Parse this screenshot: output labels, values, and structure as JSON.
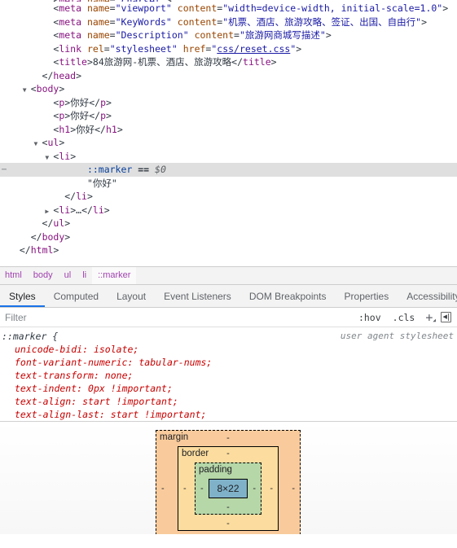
{
  "dom_tree": {
    "rows": [
      {
        "indent": 4,
        "twisty": "",
        "partial": true,
        "segments": [
          {
            "t": "punct",
            "v": "<"
          },
          {
            "t": "tagname",
            "v": "meta"
          },
          {
            "t": "punct",
            "v": " "
          },
          {
            "t": "attr",
            "v": "name"
          },
          {
            "t": "punct",
            "v": "="
          },
          {
            "t": "attrval",
            "v": "\"charset\""
          },
          {
            "t": "punct",
            "v": ">"
          }
        ]
      },
      {
        "indent": 4,
        "twisty": "",
        "segments": [
          {
            "t": "punct",
            "v": "<"
          },
          {
            "t": "tagname",
            "v": "meta"
          },
          {
            "t": "punct",
            "v": " "
          },
          {
            "t": "attr",
            "v": "name"
          },
          {
            "t": "punct",
            "v": "="
          },
          {
            "t": "attrval",
            "v": "\"viewport\""
          },
          {
            "t": "punct",
            "v": " "
          },
          {
            "t": "attr",
            "v": "content"
          },
          {
            "t": "punct",
            "v": "="
          },
          {
            "t": "attrval",
            "v": "\"width=device-width, initial-scale=1.0\""
          },
          {
            "t": "punct",
            "v": ">"
          }
        ]
      },
      {
        "indent": 4,
        "twisty": "",
        "segments": [
          {
            "t": "punct",
            "v": "<"
          },
          {
            "t": "tagname",
            "v": "meta"
          },
          {
            "t": "punct",
            "v": " "
          },
          {
            "t": "attr",
            "v": "name"
          },
          {
            "t": "punct",
            "v": "="
          },
          {
            "t": "attrval",
            "v": "\"KeyWords\""
          },
          {
            "t": "punct",
            "v": " "
          },
          {
            "t": "attr",
            "v": "content"
          },
          {
            "t": "punct",
            "v": "="
          },
          {
            "t": "attrval",
            "v": "\"机票、酒店、旅游攻略、签证、出国、自由行\""
          },
          {
            "t": "punct",
            "v": ">"
          }
        ]
      },
      {
        "indent": 4,
        "twisty": "",
        "segments": [
          {
            "t": "punct",
            "v": "<"
          },
          {
            "t": "tagname",
            "v": "meta"
          },
          {
            "t": "punct",
            "v": " "
          },
          {
            "t": "attr",
            "v": "name"
          },
          {
            "t": "punct",
            "v": "="
          },
          {
            "t": "attrval",
            "v": "\"Description\""
          },
          {
            "t": "punct",
            "v": " "
          },
          {
            "t": "attr",
            "v": "content"
          },
          {
            "t": "punct",
            "v": "="
          },
          {
            "t": "attrval",
            "v": "\"旅游网商城写描述\""
          },
          {
            "t": "punct",
            "v": ">"
          }
        ]
      },
      {
        "indent": 4,
        "twisty": "",
        "segments": [
          {
            "t": "punct",
            "v": "<"
          },
          {
            "t": "tagname",
            "v": "link"
          },
          {
            "t": "punct",
            "v": " "
          },
          {
            "t": "attr",
            "v": "rel"
          },
          {
            "t": "punct",
            "v": "="
          },
          {
            "t": "attrval",
            "v": "\"stylesheet\""
          },
          {
            "t": "punct",
            "v": " "
          },
          {
            "t": "attr",
            "v": "href"
          },
          {
            "t": "punct",
            "v": "="
          },
          {
            "t": "attrval",
            "v": "\""
          },
          {
            "t": "link",
            "v": "css/reset.css"
          },
          {
            "t": "attrval",
            "v": "\""
          },
          {
            "t": "punct",
            "v": ">"
          }
        ]
      },
      {
        "indent": 4,
        "twisty": "",
        "segments": [
          {
            "t": "punct",
            "v": "<"
          },
          {
            "t": "tagname",
            "v": "title"
          },
          {
            "t": "punct",
            "v": ">"
          },
          {
            "t": "txt",
            "v": "84旅游网-机票、酒店、旅游攻略"
          },
          {
            "t": "punct",
            "v": "</"
          },
          {
            "t": "tagname",
            "v": "title"
          },
          {
            "t": "punct",
            "v": ">"
          }
        ]
      },
      {
        "indent": 3,
        "twisty": "",
        "segments": [
          {
            "t": "punct",
            "v": "</"
          },
          {
            "t": "tagname",
            "v": "head"
          },
          {
            "t": "punct",
            "v": ">"
          }
        ]
      },
      {
        "indent": 2,
        "twisty": "▼",
        "segments": [
          {
            "t": "punct",
            "v": "<"
          },
          {
            "t": "tagname",
            "v": "body"
          },
          {
            "t": "punct",
            "v": ">"
          }
        ]
      },
      {
        "indent": 4,
        "twisty": "",
        "segments": [
          {
            "t": "punct",
            "v": "<"
          },
          {
            "t": "tagname",
            "v": "p"
          },
          {
            "t": "punct",
            "v": ">"
          },
          {
            "t": "txt",
            "v": "你好"
          },
          {
            "t": "punct",
            "v": "</"
          },
          {
            "t": "tagname",
            "v": "p"
          },
          {
            "t": "punct",
            "v": ">"
          }
        ]
      },
      {
        "indent": 4,
        "twisty": "",
        "segments": [
          {
            "t": "punct",
            "v": "<"
          },
          {
            "t": "tagname",
            "v": "p"
          },
          {
            "t": "punct",
            "v": ">"
          },
          {
            "t": "txt",
            "v": "你好"
          },
          {
            "t": "punct",
            "v": "</"
          },
          {
            "t": "tagname",
            "v": "p"
          },
          {
            "t": "punct",
            "v": ">"
          }
        ]
      },
      {
        "indent": 4,
        "twisty": "",
        "segments": [
          {
            "t": "punct",
            "v": "<"
          },
          {
            "t": "tagname",
            "v": "h1"
          },
          {
            "t": "punct",
            "v": ">"
          },
          {
            "t": "txt",
            "v": "你好"
          },
          {
            "t": "punct",
            "v": "</"
          },
          {
            "t": "tagname",
            "v": "h1"
          },
          {
            "t": "punct",
            "v": ">"
          }
        ]
      },
      {
        "indent": 3,
        "twisty": "▼",
        "segments": [
          {
            "t": "punct",
            "v": "<"
          },
          {
            "t": "tagname",
            "v": "ul"
          },
          {
            "t": "punct",
            "v": ">"
          }
        ]
      },
      {
        "indent": 4,
        "twisty": "▼",
        "segments": [
          {
            "t": "punct",
            "v": "<"
          },
          {
            "t": "tagname",
            "v": "li"
          },
          {
            "t": "punct",
            "v": ">"
          }
        ]
      },
      {
        "indent": 7,
        "twisty": "",
        "selected": true,
        "dots": "⋯",
        "segments": [
          {
            "t": "pseudo",
            "v": "::marker"
          },
          {
            "t": "eqsel",
            "v": " == "
          },
          {
            "t": "dollar",
            "v": "$0"
          }
        ]
      },
      {
        "indent": 7,
        "twisty": "",
        "segments": [
          {
            "t": "txt",
            "v": "\"你好\""
          }
        ]
      },
      {
        "indent": 5,
        "twisty": "",
        "segments": [
          {
            "t": "punct",
            "v": "</"
          },
          {
            "t": "tagname",
            "v": "li"
          },
          {
            "t": "punct",
            "v": ">"
          }
        ]
      },
      {
        "indent": 4,
        "twisty": "▶",
        "segments": [
          {
            "t": "punct",
            "v": "<"
          },
          {
            "t": "tagname",
            "v": "li"
          },
          {
            "t": "punct",
            "v": ">"
          },
          {
            "t": "punct",
            "v": "…"
          },
          {
            "t": "punct",
            "v": "</"
          },
          {
            "t": "tagname",
            "v": "li"
          },
          {
            "t": "punct",
            "v": ">"
          }
        ]
      },
      {
        "indent": 3,
        "twisty": "",
        "segments": [
          {
            "t": "punct",
            "v": "</"
          },
          {
            "t": "tagname",
            "v": "ul"
          },
          {
            "t": "punct",
            "v": ">"
          }
        ]
      },
      {
        "indent": 2,
        "twisty": "",
        "segments": [
          {
            "t": "punct",
            "v": "</"
          },
          {
            "t": "tagname",
            "v": "body"
          },
          {
            "t": "punct",
            "v": ">"
          }
        ]
      },
      {
        "indent": 1,
        "twisty": "",
        "segments": [
          {
            "t": "punct",
            "v": "</"
          },
          {
            "t": "tagname",
            "v": "html"
          },
          {
            "t": "punct",
            "v": ">"
          }
        ]
      }
    ]
  },
  "breadcrumb": {
    "items": [
      {
        "label": "html",
        "active": false
      },
      {
        "label": "body",
        "active": false
      },
      {
        "label": "ul",
        "active": false
      },
      {
        "label": "li",
        "active": false
      },
      {
        "label": "::marker",
        "active": true
      }
    ]
  },
  "tabs": {
    "items": [
      {
        "label": "Styles",
        "active": true
      },
      {
        "label": "Computed",
        "active": false
      },
      {
        "label": "Layout",
        "active": false
      },
      {
        "label": "Event Listeners",
        "active": false
      },
      {
        "label": "DOM Breakpoints",
        "active": false
      },
      {
        "label": "Properties",
        "active": false
      },
      {
        "label": "Accessibility",
        "active": false
      }
    ],
    "active_accent": "#1a73e8"
  },
  "filter_bar": {
    "placeholder": "Filter",
    "value": "",
    "hov_label": ":hov",
    "cls_label": ".cls",
    "plus_label": "+",
    "caret_label": "◢",
    "panel_icon": "◀"
  },
  "styles_pane": {
    "rule": {
      "selector": "::marker {",
      "origin": "user agent stylesheet",
      "close": "}",
      "declarations": [
        {
          "property": "unicode-bidi",
          "value": "isolate"
        },
        {
          "property": "font-variant-numeric",
          "value": "tabular-nums"
        },
        {
          "property": "text-transform",
          "value": "none"
        },
        {
          "property": "text-indent",
          "value": "0px !important"
        },
        {
          "property": "text-align",
          "value": "start !important"
        },
        {
          "property": "text-align-last",
          "value": "start !important"
        }
      ]
    }
  },
  "box_model": {
    "margin": {
      "label": "margin",
      "top": "-",
      "right": "-",
      "bottom": "-",
      "left": "-",
      "color": "#f9cb9c"
    },
    "border": {
      "label": "border",
      "top": "-",
      "right": "-",
      "bottom": "-",
      "left": "-",
      "color": "#fcdd9f"
    },
    "padding": {
      "label": "padding",
      "top": "-",
      "right": "-",
      "bottom": "-",
      "left": "-",
      "color": "#b6d7a8"
    },
    "content": {
      "size": "8×22",
      "color": "#7fb2c9"
    }
  }
}
